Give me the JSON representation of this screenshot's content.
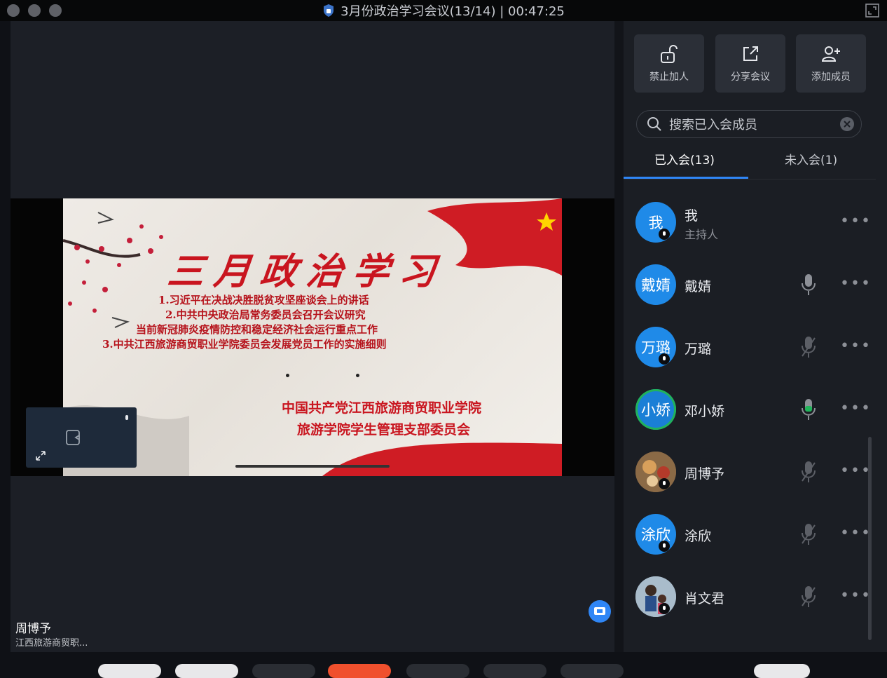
{
  "window": {
    "title": "3月份政治学习会议(13/14) | 00:47:25"
  },
  "share": {
    "slide_title": "三月政治学习",
    "lines": [
      "1.习近平在决战决胜脱贫攻坚座谈会上的讲话",
      "2.中共中央政治局常务委员会召开会议研究",
      "当前新冠肺炎疫情防控和稳定经济社会运行重点工作",
      "3.中共江西旅游商贸职业学院委员会发展党员工作的实施细则"
    ],
    "org_line1": "中国共产党江西旅游商贸职业学院",
    "org_line2": "旅游学院学生管理支部委员会"
  },
  "speaker": {
    "name": "周博予",
    "org": "江西旅游商贸职..."
  },
  "actions": [
    {
      "label": "禁止加人",
      "icon": "lock-icon"
    },
    {
      "label": "分享会议",
      "icon": "share-icon"
    },
    {
      "label": "添加成员",
      "icon": "add-user-icon"
    }
  ],
  "search": {
    "placeholder": "搜索已入会成员"
  },
  "tabs": [
    {
      "label": "已入会(13)",
      "active": true
    },
    {
      "label": "未入会(1)",
      "active": false
    }
  ],
  "members": [
    {
      "avatar_text": "我",
      "name": "我",
      "role": "主持人",
      "mic": "none"
    },
    {
      "avatar_text": "戴婧",
      "name": "戴婧",
      "mic": "on"
    },
    {
      "avatar_text": "万璐",
      "name": "万璐",
      "mic": "muted"
    },
    {
      "avatar_text": "小娇",
      "name": "邓小娇",
      "mic": "speaking"
    },
    {
      "avatar_text": "",
      "name": "周博予",
      "mic": "muted"
    },
    {
      "avatar_text": "涂欣",
      "name": "涂欣",
      "mic": "muted"
    },
    {
      "avatar_text": "",
      "name": "肖文君",
      "mic": "muted"
    }
  ],
  "more_glyph": "•••",
  "colors": {
    "accent": "#2f86f6",
    "speaking": "#21b35a",
    "slide_red": "#c9151f"
  }
}
